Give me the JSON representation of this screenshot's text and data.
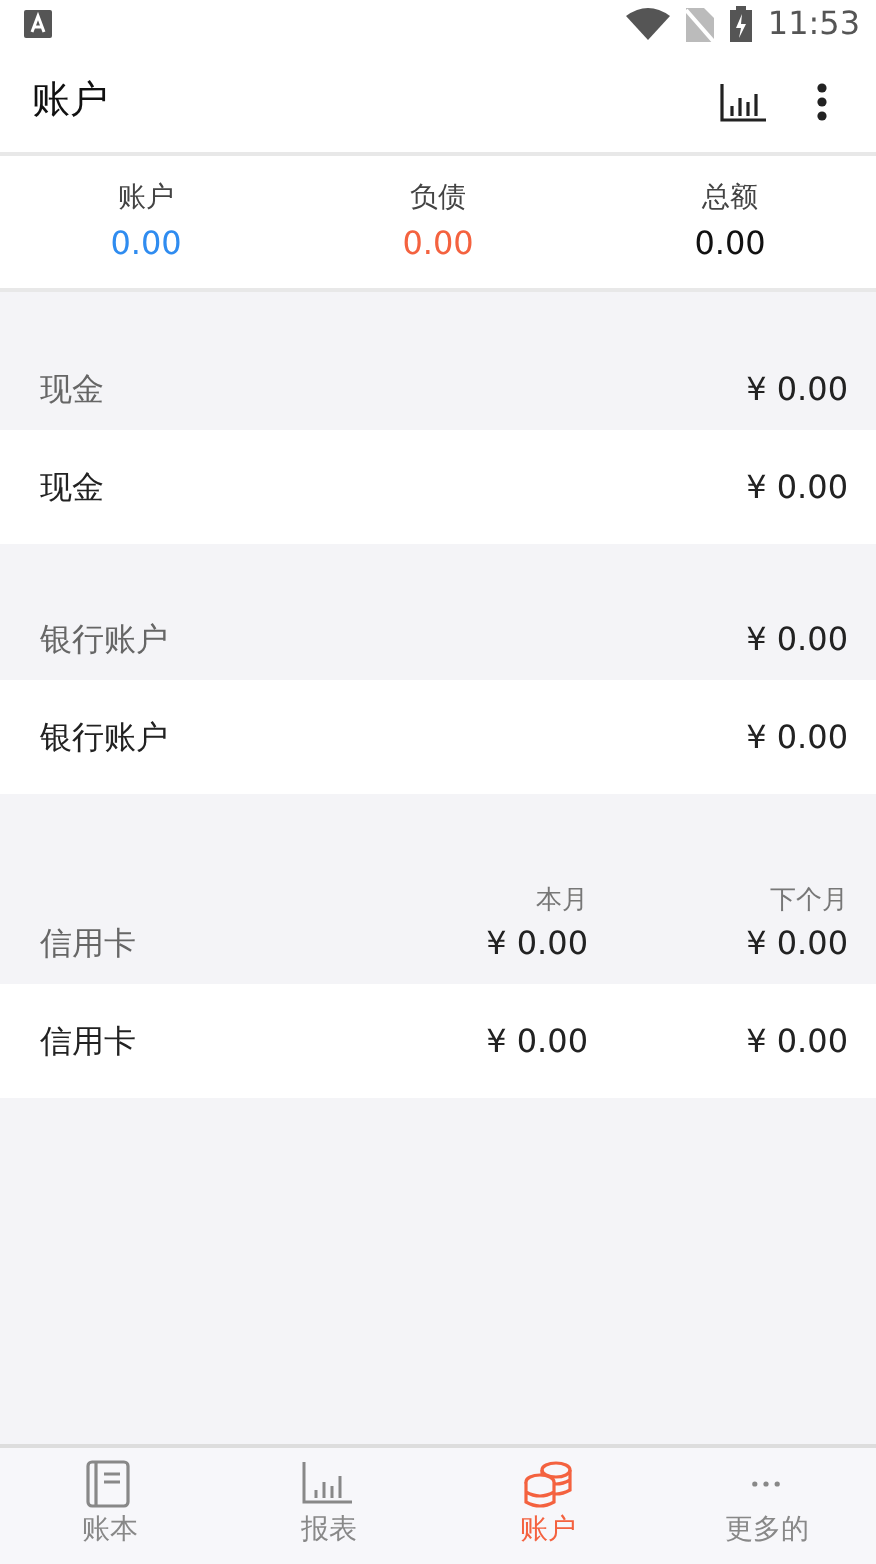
{
  "status_bar": {
    "time": "11:53"
  },
  "app_bar": {
    "title": "账户"
  },
  "summary": [
    {
      "label": "账户",
      "value": "0.00",
      "kind": "asset"
    },
    {
      "label": "负债",
      "value": "0.00",
      "kind": "liability"
    },
    {
      "label": "总额",
      "value": "0.00",
      "kind": "total"
    }
  ],
  "groups": [
    {
      "title": "现金",
      "totals": [
        "¥ 0.00"
      ],
      "accounts": [
        {
          "name": "现金",
          "amounts": [
            "¥ 0.00"
          ]
        }
      ]
    },
    {
      "title": "银行账户",
      "totals": [
        "¥ 0.00"
      ],
      "accounts": [
        {
          "name": "银行账户",
          "amounts": [
            "¥ 0.00"
          ]
        }
      ]
    },
    {
      "title": "信用卡",
      "columns": [
        "本月",
        "下个月"
      ],
      "totals": [
        "¥ 0.00",
        "¥ 0.00"
      ],
      "accounts": [
        {
          "name": "信用卡",
          "amounts": [
            "¥ 0.00",
            "¥ 0.00"
          ]
        }
      ]
    }
  ],
  "tabs": [
    {
      "label": "账本",
      "kind": "book",
      "selected": false
    },
    {
      "label": "报表",
      "kind": "chart",
      "selected": false
    },
    {
      "label": "账户",
      "kind": "coins",
      "selected": true
    },
    {
      "label": "更多的",
      "kind": "more",
      "selected": false
    }
  ]
}
